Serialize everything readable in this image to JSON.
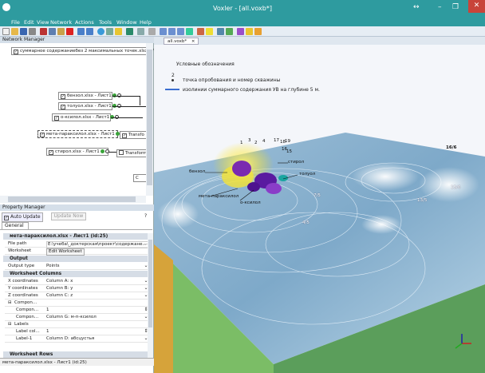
{
  "window": {
    "title": "Voxler - [all.voxb*]",
    "arrows": "↔",
    "min": "–",
    "max": "❐",
    "close": "✕"
  },
  "menu": [
    "File",
    "Edit",
    "View",
    "Network",
    "Actions",
    "Tools",
    "Window",
    "Help"
  ],
  "network_manager": {
    "title": "Network Manager",
    "root": "суммарное содержаниебез 2 максимальных точек.xlsx - Ли",
    "nodes": [
      {
        "label": "бензол.xlsx - Лист1"
      },
      {
        "label": "толуол.xlsx - Лист1"
      },
      {
        "label": "о-ксилол.xlsx - Лист1"
      },
      {
        "label": "мета-параксилол.xlsx - Лист1"
      },
      {
        "label": "стирол.xlsx - Лист1"
      }
    ],
    "transform_a": "Transfo",
    "transform_b": "Transform",
    "partial": "С"
  },
  "property_manager": {
    "title": "Property Manager",
    "auto_update": "Auto Update",
    "update_now": "Update Now",
    "help": "?",
    "tab": "General",
    "group_title": "мета-параксилол.xlsx - Лист1 (id:25)",
    "rows": [
      {
        "k": "File path",
        "v": "E:\\учеба\\_доктерская\\проект\\содержане..."
      },
      {
        "k": "Worksheet",
        "v": "Edit Worksheet"
      }
    ],
    "output_section": "Output",
    "output_type": {
      "k": "Output type",
      "v": "Points"
    },
    "ws_section": "Worksheet Columns",
    "columns": [
      {
        "k": "X coordinates",
        "v": "Column A: x"
      },
      {
        "k": "Y coordinates",
        "v": "Column B: y"
      },
      {
        "k": "Z coordinates",
        "v": "Column C: z"
      }
    ],
    "components_title": "Compon...",
    "components": [
      {
        "k": "Compon...",
        "v": "1"
      },
      {
        "k": "Compon...",
        "v": "Column G: м-п-ксилол"
      }
    ],
    "labels_title": "Labels",
    "labels": [
      {
        "k": "Label col...",
        "v": "1"
      },
      {
        "k": "Label-1",
        "v": "Column D: абсцустья"
      }
    ],
    "ws_rows": "Worksheet Rows",
    "status": "мета-параксилол.xlsx - Лист1 (id:25)"
  },
  "doc_tab": "all.voxb*",
  "legend": {
    "title": "Условные обозначения",
    "point_num": "2",
    "point_text": "точка опробования и номер скважины",
    "line_text": "изолинии суммарного содержания УВ на глубине 5 м."
  },
  "labels_3d": [
    "бензол",
    "стирол",
    "толуол",
    "о-ксилол",
    "мета-параксилол"
  ],
  "well_numbers": [
    "1",
    "3",
    "2",
    "4",
    "17",
    "18",
    "19",
    "16",
    "15"
  ],
  "contour_values": [
    "16/6",
    "15/6",
    "13/5",
    "7/5",
    "4/5"
  ],
  "colors": {
    "titlebar": "#2e9b9f",
    "volume": "#5a1aa0",
    "highlight": "#ffee00"
  }
}
